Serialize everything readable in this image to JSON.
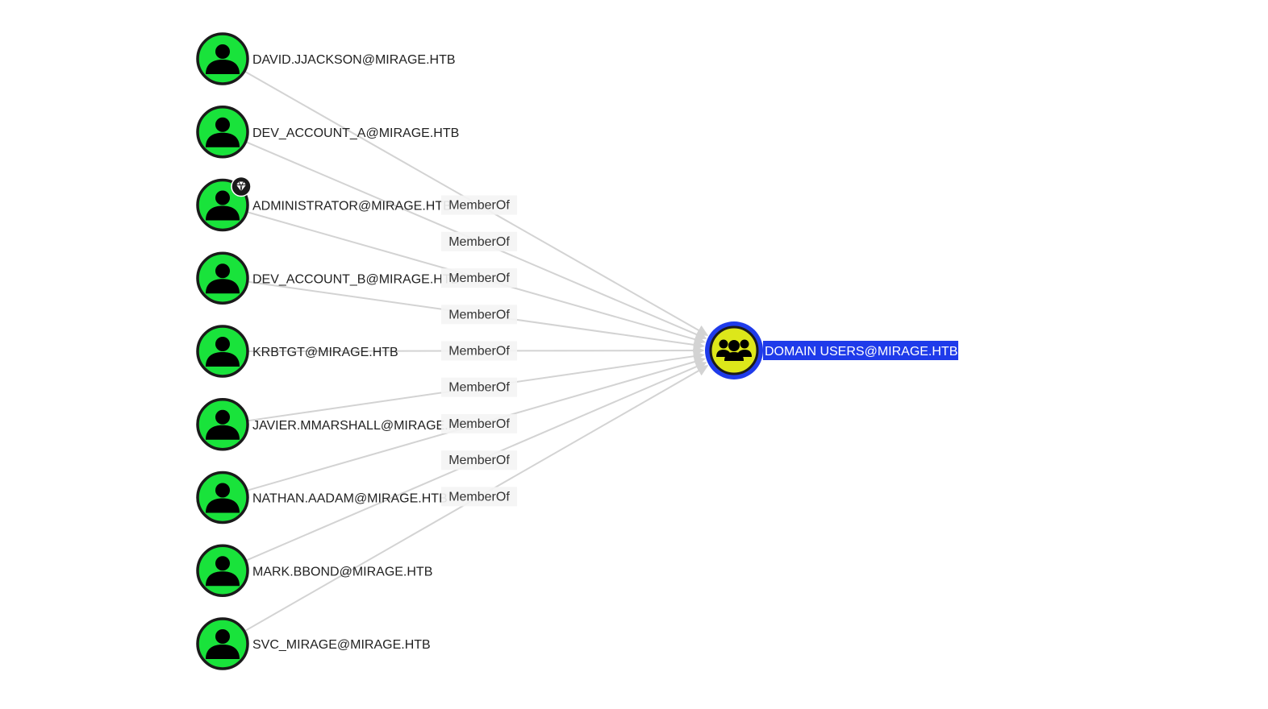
{
  "graph": {
    "target": {
      "name": "DOMAIN USERS@MIRAGE.HTB",
      "icon": "group-icon",
      "fill_color": "#dde71a",
      "ring_color": "#1f3bea",
      "label_bg_color": "#1f3bea",
      "selected": true
    },
    "edge_label": "MemberOf",
    "edge_color": "#d3d3d3",
    "user_fill_color": "#19e33b",
    "users": [
      {
        "name": "DAVID.JJACKSON@MIRAGE.HTB",
        "icon": "user-icon"
      },
      {
        "name": "DEV_ACCOUNT_A@MIRAGE.HTB",
        "icon": "user-icon"
      },
      {
        "name": "ADMINISTRATOR@MIRAGE.HTB",
        "icon": "user-icon",
        "badge": "gem-icon"
      },
      {
        "name": "DEV_ACCOUNT_B@MIRAGE.HTB",
        "icon": "user-icon"
      },
      {
        "name": "KRBTGT@MIRAGE.HTB",
        "icon": "user-icon"
      },
      {
        "name": "JAVIER.MMARSHALL@MIRAGE.HTB",
        "icon": "user-icon"
      },
      {
        "name": "NATHAN.AADAM@MIRAGE.HTB",
        "icon": "user-icon"
      },
      {
        "name": "MARK.BBOND@MIRAGE.HTB",
        "icon": "user-icon"
      },
      {
        "name": "SVC_MIRAGE@MIRAGE.HTB",
        "icon": "user-icon"
      }
    ]
  }
}
